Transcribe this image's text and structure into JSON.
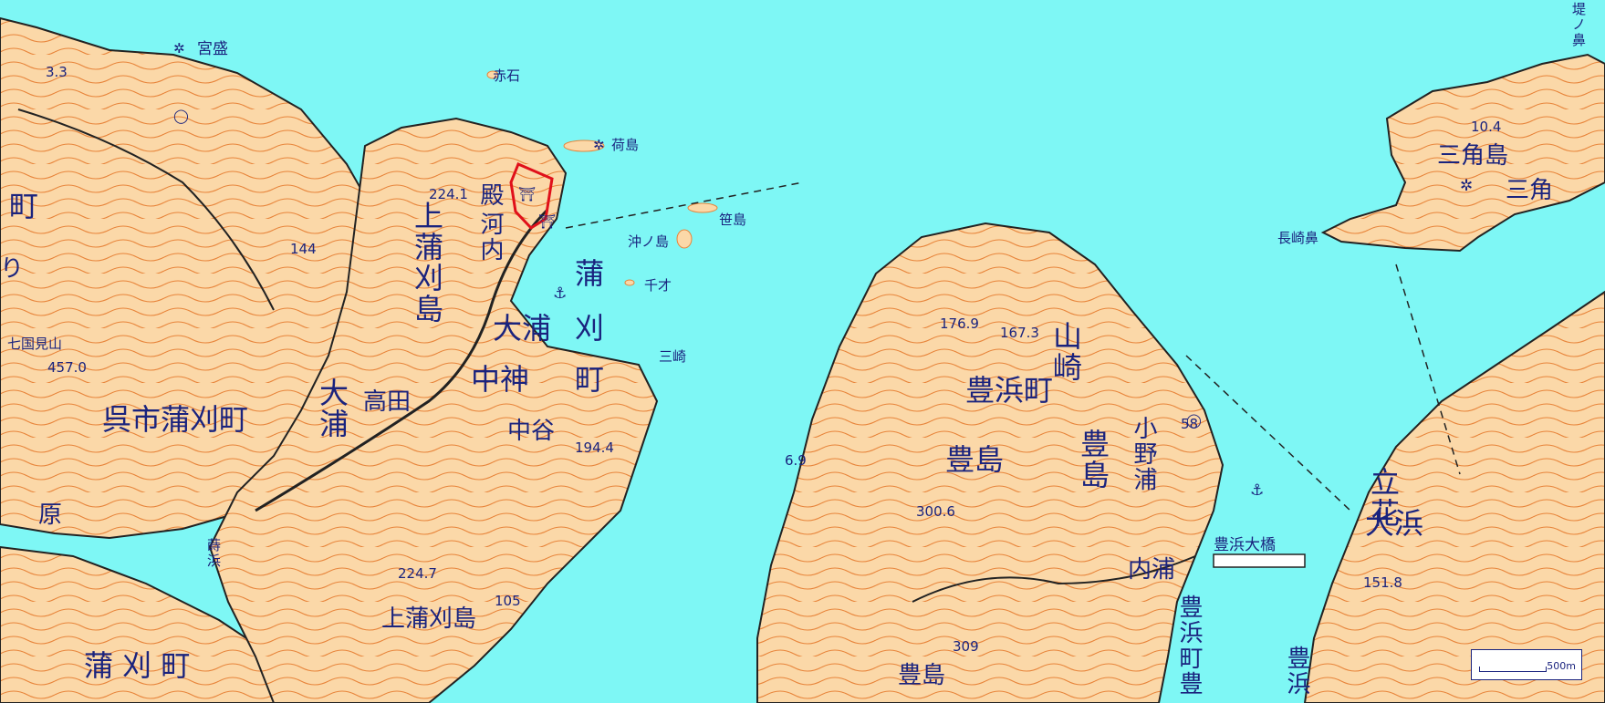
{
  "map": {
    "colors": {
      "sea": "#7ef7f5",
      "land": "#fbd8a8",
      "contour": "#e8843a",
      "road": "#222222",
      "label": "#1a237e",
      "highlight": "#e0101a"
    },
    "places": {
      "miyamori": "宮盛",
      "akaishi": "赤石",
      "nishima": "荷島",
      "sasajima": "笹島",
      "okinoshima": "沖ノ島",
      "chitose": "千才",
      "misaki": "三崎",
      "tsutsumi": "堤ノ鼻",
      "misumijima": "三角島",
      "misumi": "三角",
      "nagasakibana": "長崎鼻",
      "tono": "殿",
      "kawauchi": "河内",
      "kamikamagari_v": "上蒲刈島",
      "kama": "蒲",
      "kari": "刈",
      "oura_top": "大浦",
      "chojin": "中神",
      "machi": "町",
      "takata": "高田",
      "oura_v": "大浦",
      "nakaya": "中谷",
      "kure_kamagari": "呉市蒲刈町",
      "shichikokumiyama": "七国見山",
      "hara": "原",
      "kamikamagarijima": "上蒲刈島",
      "kamagari_machi": "蒲 刈 町",
      "yamazaki": "山崎",
      "toyohama_machi": "豊浜町",
      "toyoshima_main": "豊島",
      "toyoshima_v": "豊島",
      "onoura": "小野浦",
      "uchiura": "内浦",
      "toyohama_bridge": "豊浜大橋",
      "toyohama_toyo": "豊浜町豊",
      "toyoshima_bottom": "豊島",
      "tachibana": "立花",
      "ohama": "大浜",
      "toyohama_r": "豊浜",
      "cho_left": "町",
      "ri_left": "り",
      "tatehama": "蒔浜"
    },
    "elevations": {
      "e33": "3.3",
      "e2241": "224.1",
      "e144": "144",
      "e4570": "457.0",
      "e1944": "194.4",
      "e2247": "224.7",
      "e105": "105",
      "e1769": "176.9",
      "e1673": "167.3",
      "e58": "58",
      "e69": "6.9",
      "e3006": "300.6",
      "e309": "309",
      "e104": "10.4",
      "e1518": "151.8"
    },
    "scale": {
      "label": "500m"
    }
  }
}
